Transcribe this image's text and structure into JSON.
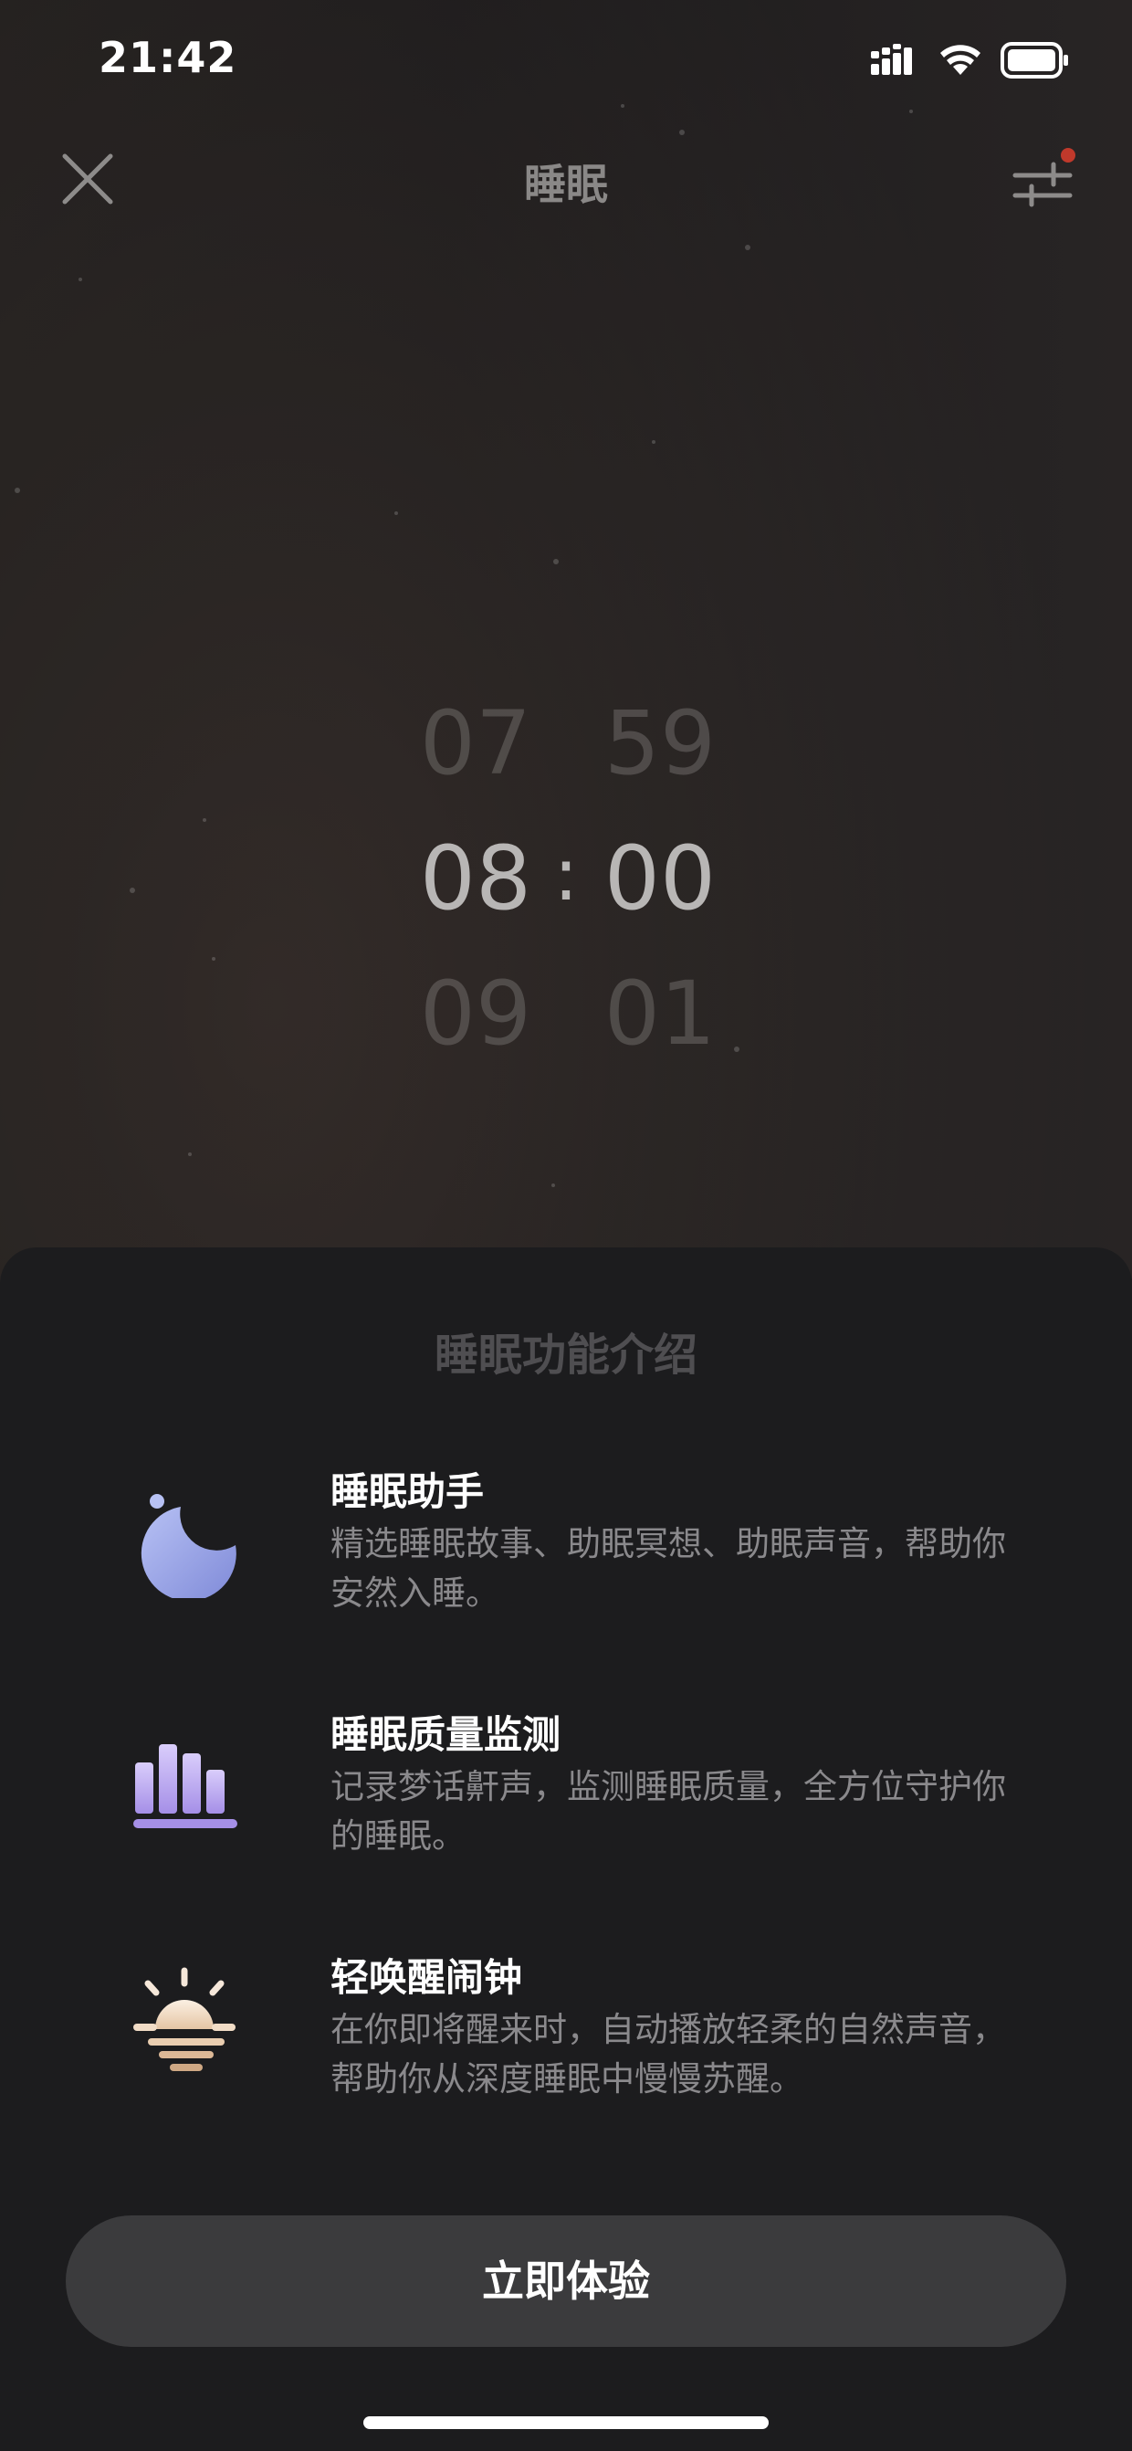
{
  "status_bar": {
    "time": "21:42"
  },
  "nav": {
    "title": "睡眠"
  },
  "picker": {
    "hours": [
      "07",
      "08",
      "09"
    ],
    "minutes": [
      "59",
      "00",
      "01"
    ],
    "separator": ":",
    "selected_time": "08:00"
  },
  "sheet": {
    "title": "睡眠功能介绍",
    "features": [
      {
        "icon": "moon-icon",
        "title": "睡眠助手",
        "desc": "精选睡眠故事、助眠冥想、助眠声音，帮助你安然入睡。"
      },
      {
        "icon": "bar-chart-icon",
        "title": "睡眠质量监测",
        "desc": "记录梦话鼾声，监测睡眠质量，全方位守护你的睡眠。"
      },
      {
        "icon": "sunrise-icon",
        "title": "轻唤醒闹钟",
        "desc": "在你即将醒来时，自动播放轻柔的自然声音，帮助你从深度睡眠中慢慢苏醒。"
      }
    ],
    "cta_label": "立即体验"
  },
  "colors": {
    "sheet_bg": "#1c1c1e",
    "cta_bg": "#3b3b3d",
    "settings_dot": "#c0392b",
    "moon": "#9aa5e6",
    "bars": "#b9a8ee",
    "sun": "#f3dcc4"
  }
}
